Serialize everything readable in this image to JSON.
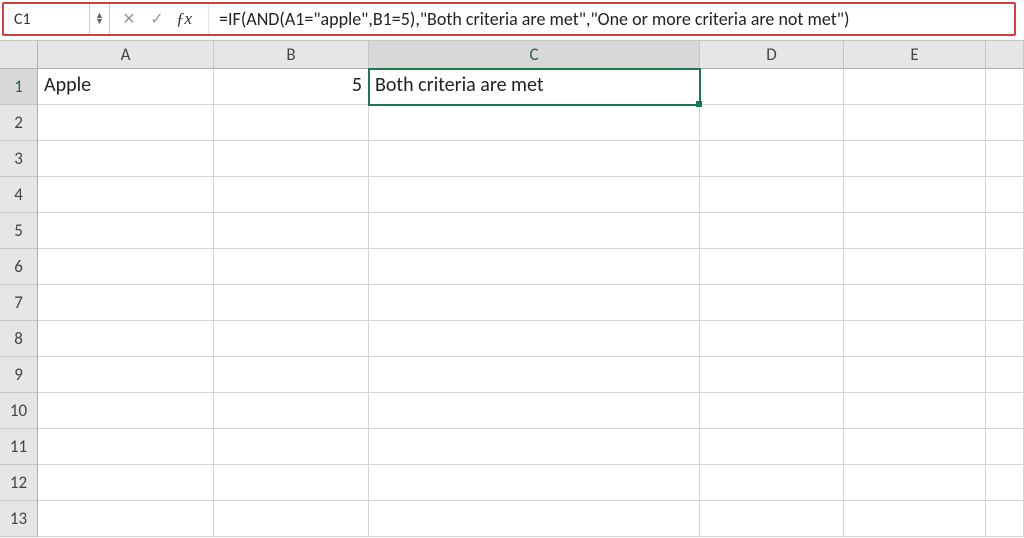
{
  "formulaBar": {
    "nameBox": "C1",
    "formula": "=IF(AND(A1=\"apple\",B1=5),\"Both criteria are met\",\"One or more criteria are not met\")"
  },
  "columns": [
    "A",
    "B",
    "C",
    "D",
    "E",
    ""
  ],
  "rows": [
    "1",
    "2",
    "3",
    "4",
    "5",
    "6",
    "7",
    "8",
    "9",
    "10",
    "11",
    "12",
    "13"
  ],
  "cells": {
    "A1": "Apple",
    "B1": "5",
    "C1": "Both criteria are met"
  },
  "activeCell": "C1"
}
